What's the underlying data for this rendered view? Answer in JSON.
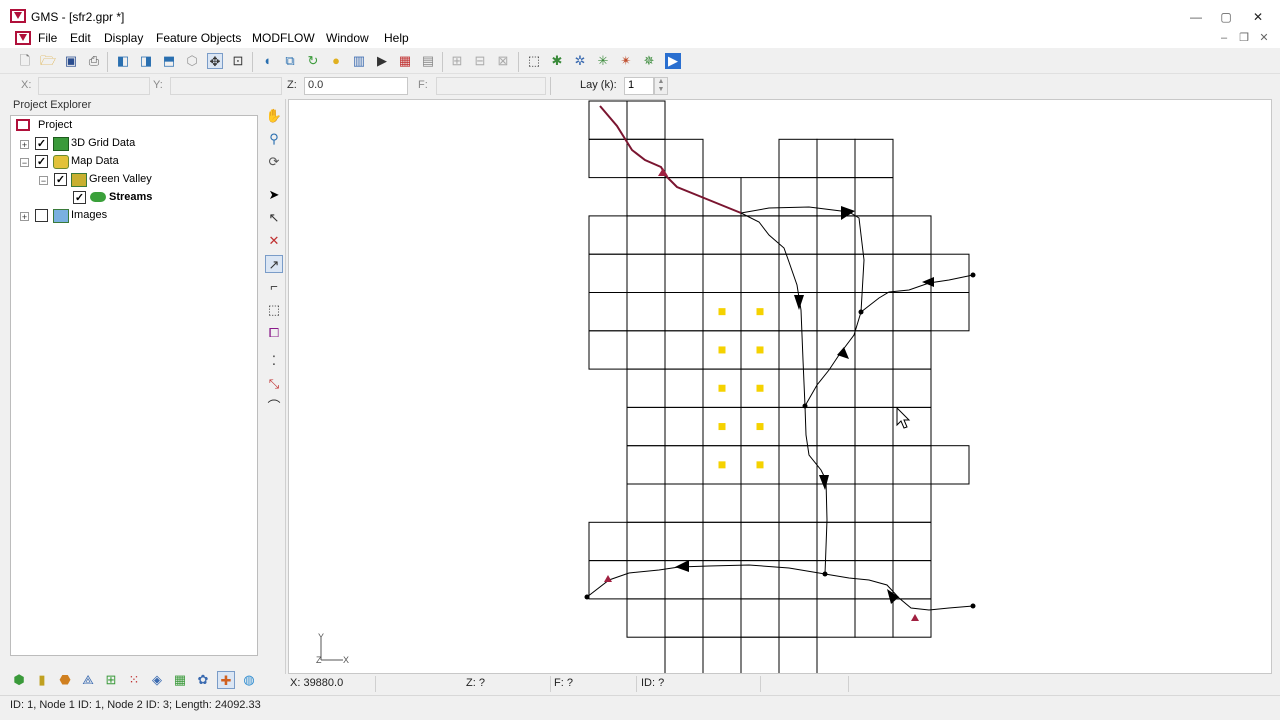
{
  "window": {
    "title": "GMS - [sfr2.gpr *]",
    "minimize": "—",
    "maximize": "▢",
    "close": "✕"
  },
  "menu": [
    "File",
    "Edit",
    "Display",
    "Feature Objects",
    "MODFLOW",
    "Window",
    "Help"
  ],
  "mdi": {
    "minimize": "–",
    "restore": "❐",
    "close": "✕"
  },
  "coordbar": {
    "x_label": "X:",
    "y_label": "Y:",
    "z_label": "Z:",
    "z_value": "0.0",
    "f_label": "F:",
    "lay_label": "Lay (k):",
    "lay_value": "1"
  },
  "explorer": {
    "title": "Project Explorer",
    "items": [
      {
        "label": "Project",
        "checked": null
      },
      {
        "label": "3D Grid Data",
        "checked": true
      },
      {
        "label": "Map Data",
        "checked": true
      },
      {
        "label": "Green Valley",
        "checked": true
      },
      {
        "label": "Streams",
        "checked": true
      },
      {
        "label": "Images",
        "checked": false
      }
    ]
  },
  "icons": {
    "toolbar": [
      "new-file-icon",
      "open-folder-icon",
      "save-icon",
      "print-icon",
      "cube-front-icon",
      "cube-side-icon",
      "cube-top-icon",
      "cube-oblique-icon",
      "rotate-icon",
      "zoom-frame-icon",
      "zoom-icon",
      "info-icon",
      "layers-icon",
      "refresh-icon",
      "light-icon",
      "chart-icon",
      "animation-icon",
      "color-ramp-icon",
      "list-icon",
      "grid-a-icon",
      "grid-b-icon",
      "grid-c-icon",
      "tool-a-icon",
      "tool-b-icon",
      "tool-c-icon",
      "tool-d-icon",
      "tool-e-icon",
      "run-icon"
    ],
    "vertical": [
      "pan-icon",
      "zoom-tool-icon",
      "rotate-tool-icon",
      "select-arrow-icon",
      "select-vertex-icon",
      "create-node-icon",
      "create-arc-icon",
      "select-arc-icon",
      "select-polygon-icon",
      "grid-frame-icon",
      "points-icon",
      "create-vertex-icon",
      "create-curve-icon"
    ],
    "modules": [
      "tin-module-icon",
      "borehole-module-icon",
      "solid-module-icon",
      "mesh-module-icon",
      "grid-module-icon",
      "scatter-module-icon",
      "map-module-icon",
      "3d-grid-module-icon",
      "gis-module-icon",
      "uGrid-module-icon",
      "globe-module-icon"
    ]
  },
  "triad": {
    "y": "Y",
    "x": "X",
    "z": "Z"
  },
  "status": {
    "x": "X: 39880.0",
    "z": "Z: ?",
    "f": "F: ?",
    "id": "ID: ?"
  },
  "statusbar": "ID: 1, Node 1 ID: 1, Node 2 ID: 3; Length: 24092.33",
  "colors": {
    "accent": "#b0103a",
    "well": "#f5d200",
    "stream_selected": "#7a1530",
    "grid": "#000000"
  }
}
